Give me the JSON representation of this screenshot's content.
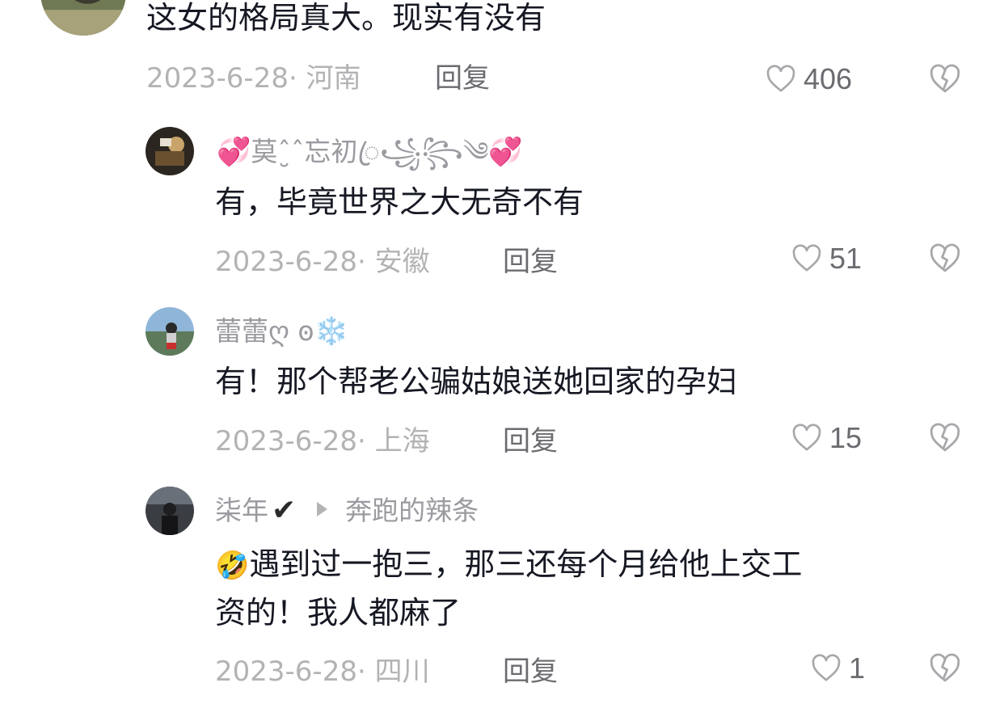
{
  "comments": [
    {
      "text": "这女的格局真大。现实有没有",
      "date": "2023-6-28",
      "location": "河南",
      "reply_label": "回复",
      "likes": "406"
    },
    {
      "username": "莫ˆ̮ˆ忘初ꦿ꧁꧂༄",
      "emoji_before": "💞",
      "emoji_after": "💞",
      "text": "有，毕竟世界之大无奇不有",
      "date": "2023-6-28",
      "location": "安徽",
      "reply_label": "回复",
      "likes": "51"
    },
    {
      "username": "蕾蕾ღ ꙩ",
      "emoji_after": "❄️",
      "text": "有！那个帮老公骗姑娘送她回家的孕妇",
      "date": "2023-6-28",
      "location": "上海",
      "reply_label": "回复",
      "likes": "15"
    },
    {
      "username": "柒年",
      "verified_mark": "✔",
      "reply_to": "奔跑的辣条",
      "emoji_before": "🤣",
      "text_line1": "遇到过一抱三，那三还每个月给他上交工",
      "text_line2": "资的！我人都麻了",
      "date": "2023-6-28",
      "location": "四川",
      "reply_label": "回复",
      "likes": "1"
    }
  ],
  "meta_separator": "·",
  "icons": {
    "like": "heart-outline-icon",
    "dislike": "broken-heart-icon"
  },
  "colors": {
    "text": "#161823",
    "meta": "#b3b3b6",
    "secondary": "#6b6b70"
  }
}
